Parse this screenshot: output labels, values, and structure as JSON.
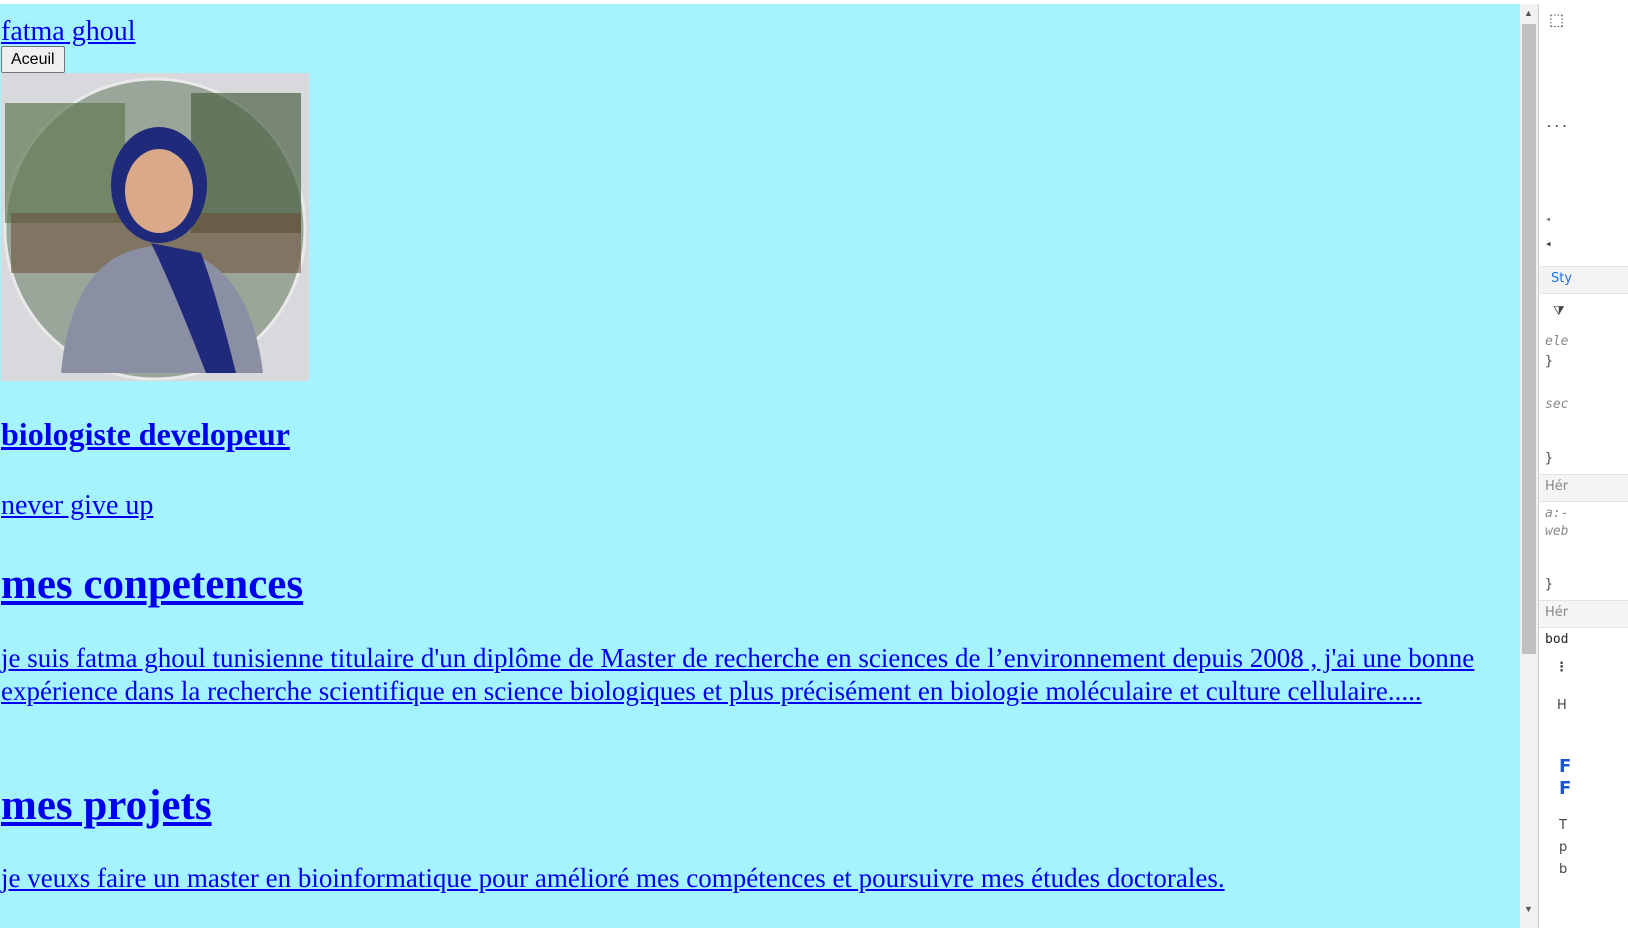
{
  "header": {
    "brand": "fatma ghoul",
    "home_button": "Aceuil"
  },
  "hero": {
    "role": "biologiste developeur",
    "motto": "never give up"
  },
  "skills": {
    "title": "mes conpetences",
    "text": "je suis fatma ghoul tunisienne titulaire d'un diplôme de Master de recherche en sciences de l’environnement depuis 2008 , j'ai une bonne expérience dans la recherche scientifique en science biologiques et plus précisément en biologie moléculaire et culture cellulaire....."
  },
  "projects": {
    "title": "mes projets",
    "text": "je veuxs faire un master en bioinformatique pour amélioré mes compétences et poursuivre mes études doctorales."
  },
  "devtools": {
    "dots": "...",
    "styles_tab": "Sty",
    "element_rule": "ele",
    "brace": "}",
    "section_rule": "sec",
    "inherited_1": "Hér",
    "a_rule": "a:-",
    "webkit_rule": "web",
    "inherited_2": "Hér",
    "body_rule": "bod",
    "panel_h": "H",
    "panel_f1": "F",
    "panel_f2": "F",
    "panel_t": "T",
    "panel_p": "p",
    "panel_b": "b"
  },
  "colors": {
    "page_background": "#a5f3fc",
    "link": "#0000ee"
  }
}
